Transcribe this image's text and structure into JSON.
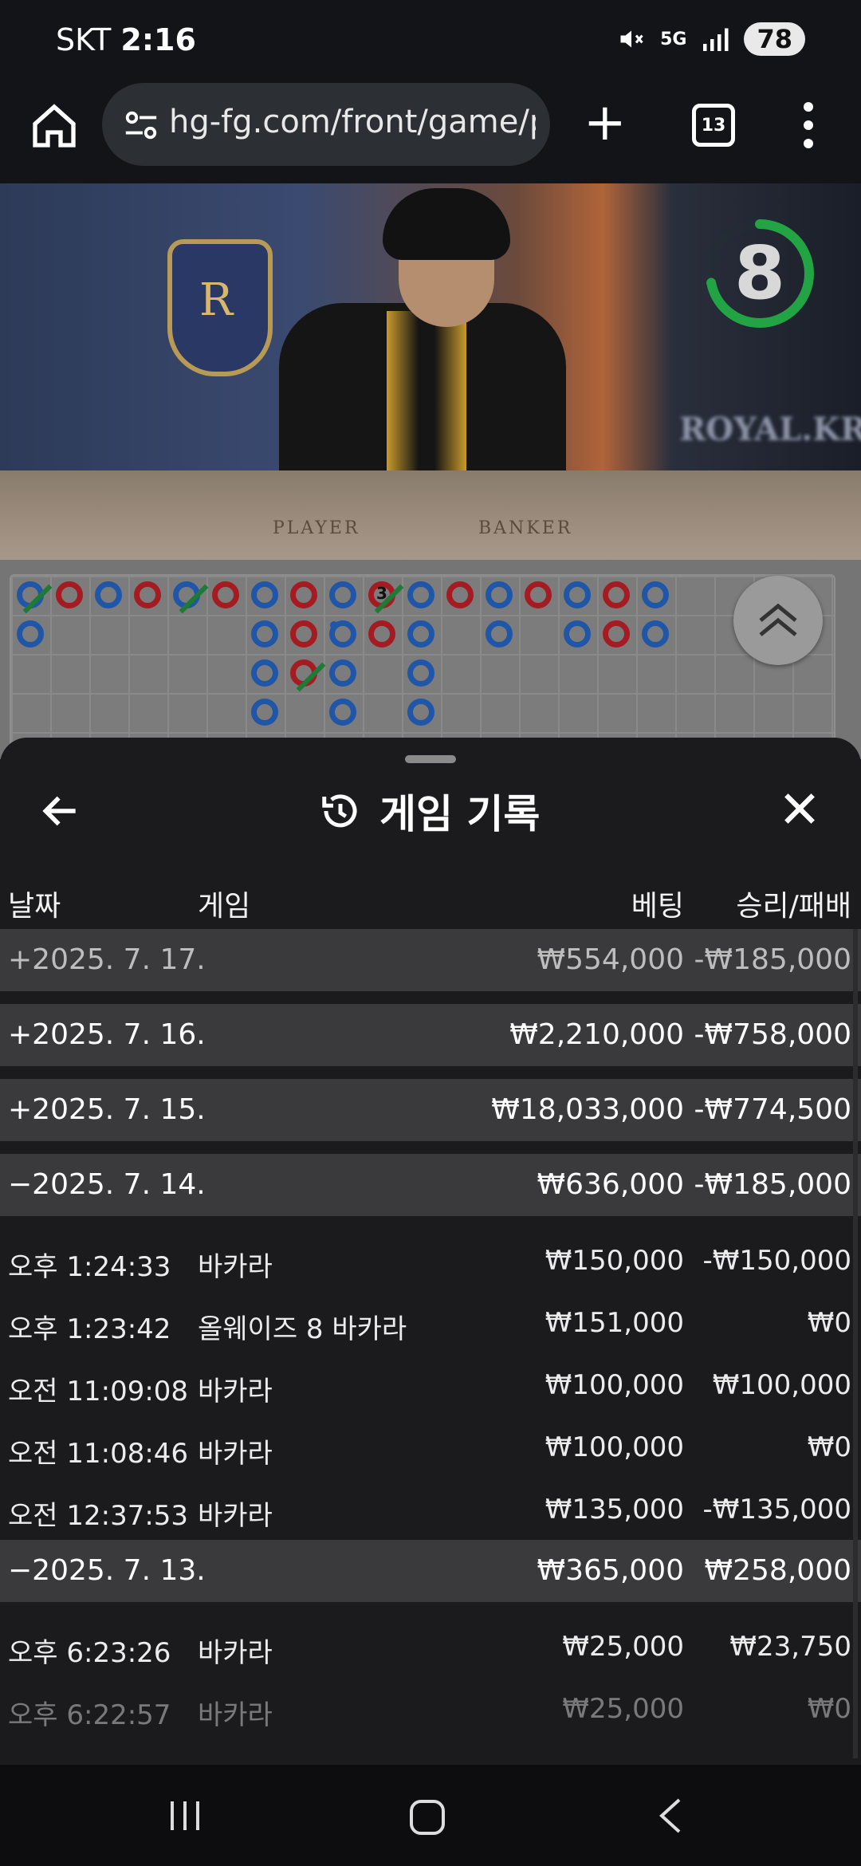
{
  "status_bar": {
    "carrier": "SKT",
    "time": "2:16",
    "network": "5G",
    "battery": "78"
  },
  "browser": {
    "url": "hg-fg.com/front/game/p",
    "tab_count": "13"
  },
  "video": {
    "timer": "8",
    "table_label_player": "PLAYER",
    "table_label_banker": "BANKER",
    "brand_watermark": "ROYAL.KR",
    "crest_letter": "R"
  },
  "roadmap": {
    "beads": [
      {
        "col": 0,
        "row": 0,
        "side": "P",
        "tie": true
      },
      {
        "col": 0,
        "row": 1,
        "side": "P"
      },
      {
        "col": 1,
        "row": 0,
        "side": "B"
      },
      {
        "col": 2,
        "row": 0,
        "side": "P"
      },
      {
        "col": 3,
        "row": 0,
        "side": "B"
      },
      {
        "col": 4,
        "row": 0,
        "side": "P",
        "tie": true
      },
      {
        "col": 5,
        "row": 0,
        "side": "B"
      },
      {
        "col": 6,
        "row": 0,
        "side": "P"
      },
      {
        "col": 6,
        "row": 1,
        "side": "P"
      },
      {
        "col": 6,
        "row": 2,
        "side": "P"
      },
      {
        "col": 6,
        "row": 3,
        "side": "P"
      },
      {
        "col": 7,
        "row": 0,
        "side": "B"
      },
      {
        "col": 7,
        "row": 1,
        "side": "B"
      },
      {
        "col": 7,
        "row": 2,
        "side": "B",
        "tie": true
      },
      {
        "col": 8,
        "row": 0,
        "side": "P"
      },
      {
        "col": 8,
        "row": 1,
        "side": "P",
        "dot": true
      },
      {
        "col": 8,
        "row": 2,
        "side": "P"
      },
      {
        "col": 8,
        "row": 3,
        "side": "P"
      },
      {
        "col": 9,
        "row": 0,
        "side": "B",
        "tie": true,
        "count": "3"
      },
      {
        "col": 9,
        "row": 1,
        "side": "B"
      },
      {
        "col": 10,
        "row": 0,
        "side": "P"
      },
      {
        "col": 10,
        "row": 1,
        "side": "P"
      },
      {
        "col": 10,
        "row": 2,
        "side": "P"
      },
      {
        "col": 10,
        "row": 3,
        "side": "P"
      },
      {
        "col": 11,
        "row": 0,
        "side": "B"
      },
      {
        "col": 12,
        "row": 0,
        "side": "P"
      },
      {
        "col": 12,
        "row": 1,
        "side": "P"
      },
      {
        "col": 13,
        "row": 0,
        "side": "B"
      },
      {
        "col": 14,
        "row": 0,
        "side": "P"
      },
      {
        "col": 14,
        "row": 1,
        "side": "P"
      },
      {
        "col": 15,
        "row": 0,
        "side": "B"
      },
      {
        "col": 15,
        "row": 1,
        "side": "B"
      },
      {
        "col": 16,
        "row": 0,
        "side": "P"
      },
      {
        "col": 16,
        "row": 1,
        "side": "P"
      }
    ]
  },
  "history": {
    "title": "게임 기록",
    "columns": {
      "date": "날짜",
      "game": "게임",
      "bet": "베팅",
      "result": "승리/패배"
    },
    "rows": [
      {
        "type": "day",
        "label": "+2025. 7. 17.",
        "bet": "₩554,000",
        "result": "-₩185,000"
      },
      {
        "type": "day",
        "label": "+2025. 7. 16.",
        "bet": "₩2,210,000",
        "result": "-₩758,000"
      },
      {
        "type": "day",
        "label": "+2025. 7. 15.",
        "bet": "₩18,033,000",
        "result": "-₩774,500"
      },
      {
        "type": "day",
        "label": "−2025. 7. 14.",
        "bet": "₩636,000",
        "result": "-₩185,000"
      },
      {
        "type": "detail",
        "time": "오후 1:24:33",
        "game": "바카라",
        "bet": "₩150,000",
        "result": "-₩150,000"
      },
      {
        "type": "detail",
        "time": "오후 1:23:42",
        "game": "올웨이즈 8 바카라",
        "bet": "₩151,000",
        "result": "₩0"
      },
      {
        "type": "detail",
        "time": "오전 11:09:08",
        "game": "바카라",
        "bet": "₩100,000",
        "result": "₩100,000"
      },
      {
        "type": "detail",
        "time": "오전 11:08:46",
        "game": "바카라",
        "bet": "₩100,000",
        "result": "₩0"
      },
      {
        "type": "detail",
        "time": "오전 12:37:53",
        "game": "바카라",
        "bet": "₩135,000",
        "result": "-₩135,000"
      },
      {
        "type": "day",
        "label": "−2025. 7. 13.",
        "bet": "₩365,000",
        "result": "₩258,000"
      },
      {
        "type": "detail",
        "time": "오후 6:23:26",
        "game": "바카라",
        "bet": "₩25,000",
        "result": "₩23,750"
      },
      {
        "type": "detail",
        "time": "오후 6:22:57",
        "game": "바카라",
        "bet": "₩25,000",
        "result": "₩0"
      }
    ]
  },
  "colors": {
    "player": "#1f56a8",
    "banker": "#a51b22",
    "tie": "#1f7a35",
    "timer_ring": "#22a445"
  }
}
